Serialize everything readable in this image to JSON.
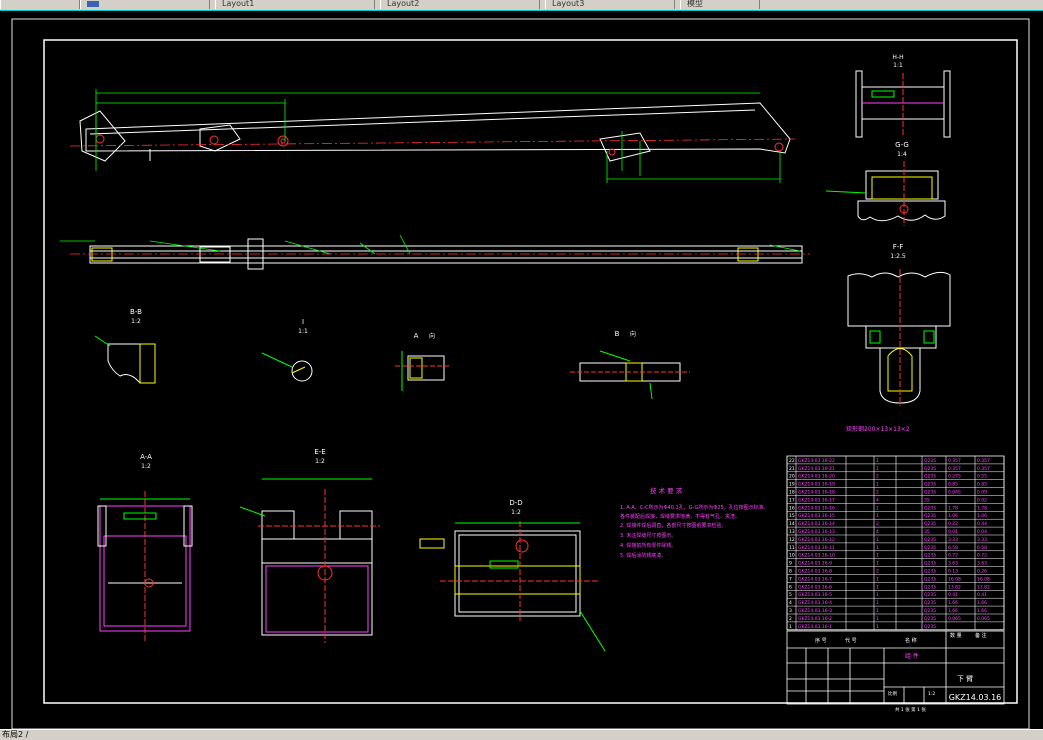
{
  "tabs": [
    {
      "label": ""
    },
    {
      "label": ""
    },
    {
      "label": "Layout1"
    },
    {
      "label": "Layout2"
    },
    {
      "label": "Layout3"
    },
    {
      "label": "模型"
    }
  ],
  "views": {
    "hh": {
      "title": "H-H",
      "scale": "1:1"
    },
    "gg": {
      "title": "G-G",
      "scale": "1:4"
    },
    "ff": {
      "title": "F-F",
      "scale": "1:2.5"
    },
    "bb": {
      "title": "B-B",
      "scale": "1:2"
    },
    "i": {
      "title": "I",
      "scale": "1:1"
    },
    "a": {
      "title": "A",
      "scale": "向"
    },
    "b": {
      "title": "B",
      "scale": "向"
    },
    "aa": {
      "title": "A-A",
      "scale": "1:2"
    },
    "ee": {
      "title": "E-E",
      "scale": "1:2"
    },
    "dd": {
      "title": "D-D",
      "scale": "1:2"
    }
  },
  "material_note": "矩形钢200×13×13×2",
  "tech_req": {
    "title": "技 术 要 求",
    "lines": [
      "1. A-A、C-C所示为Φ40.1孔，G-G所示为Φ25，孔位按图示标准。",
      "各件装配后焊接，焊缝要求饱满，不得有气孔、夹渣。",
      "2. 焊接件焊后调直，各部尺寸按图纸要求检验。",
      "3. 未注焊缝尺寸按图示。",
      "4. 焊接前所有零件除锈。",
      "5. 焊后涂防锈底漆。"
    ]
  },
  "bom_rows": [
    [
      "22",
      "GKZ14.03.16-22",
      "",
      "1",
      "",
      "Q235",
      "0.357",
      "0.357"
    ],
    [
      "21",
      "GKZ14.03.16-21",
      "",
      "1",
      "",
      "Q235",
      "0.357",
      "0.357"
    ],
    [
      "20",
      "GKZ14.03.16-20",
      "",
      "2",
      "",
      "Q235",
      "0.275",
      "0.55"
    ],
    [
      "19",
      "GKZ14.03.16-19",
      "",
      "1",
      "",
      "Q235",
      "0.85",
      "0.85"
    ],
    [
      "18",
      "GKZ14.03.16-18",
      "",
      "2",
      "",
      "Q235",
      "0.045",
      "0.09"
    ],
    [
      "17",
      "GKZ14.03.16-17",
      "",
      "4",
      "",
      "35",
      "",
      "0.02"
    ],
    [
      "16",
      "GKZ14.03.16-16",
      "",
      "1",
      "",
      "Q235",
      "1.78",
      "1.78"
    ],
    [
      "15",
      "GKZ14.03.16-15",
      "",
      "1",
      "",
      "Q235",
      "1.06",
      "1.06"
    ],
    [
      "14",
      "GKZ14.03.16-14",
      "",
      "2",
      "",
      "Q235",
      "0.22",
      "0.44"
    ],
    [
      "13",
      "GKZ14.03.16-13",
      "",
      "4",
      "",
      "35",
      "0.01",
      "0.04"
    ],
    [
      "12",
      "GKZ14.03.16-12",
      "",
      "1",
      "",
      "Q235",
      "3.33",
      "3.33"
    ],
    [
      "11",
      "GKZ14.03.16-11",
      "",
      "1",
      "",
      "Q235",
      "6.58",
      "6.58"
    ],
    [
      "10",
      "GKZ14.03.16-10",
      "",
      "1",
      "",
      "Q235",
      "0.72",
      "0.72"
    ],
    [
      "9",
      "GKZ14.03.16-9",
      "",
      "1",
      "",
      "Q235",
      "3.63",
      "3.63"
    ],
    [
      "8",
      "GKZ14.03.16-8",
      "",
      "2",
      "",
      "Q235",
      "0.13",
      "0.26"
    ],
    [
      "7",
      "GKZ14.03.16-7",
      "",
      "1",
      "",
      "Q235",
      "16.08",
      "16.08"
    ],
    [
      "6",
      "GKZ14.03.16-6",
      "",
      "1",
      "",
      "Q235",
      "13.82",
      "13.82"
    ],
    [
      "5",
      "GKZ14.03.16-5",
      "",
      "1",
      "",
      "Q235",
      "0.41",
      "0.41"
    ],
    [
      "4",
      "GKZ14.03.16-4",
      "",
      "1",
      "",
      "Q235",
      "1.66",
      "1.66"
    ],
    [
      "3",
      "GKZ14.03.16-3",
      "",
      "1",
      "",
      "Q235",
      "1.66",
      "1.66"
    ],
    [
      "2",
      "GKZ14.03.16-2",
      "",
      "1",
      "",
      "Q235",
      "0.065",
      "0.065"
    ],
    [
      "1",
      "GKZ14.03.16-1",
      "",
      "1",
      "",
      "Q235",
      "",
      ""
    ]
  ],
  "title_block": {
    "part_name": "下 臂",
    "drawing_no": "GKZ14.03.16",
    "hdr_seq": "序 号",
    "hdr_code": "代 号",
    "hdr_name": "名 称",
    "hdr_qty": "数 量",
    "hdr_mat": "材 料",
    "hdr_unit": "单 件",
    "hdr_total": "总 计",
    "hdr_weight": "重 量",
    "hdr_note": "备 注",
    "material": "组 件",
    "scale_label": "比例",
    "scale_value": "1:2",
    "sheet": "共 1 张  第 1 张"
  },
  "status_text": "布局2 / "
}
